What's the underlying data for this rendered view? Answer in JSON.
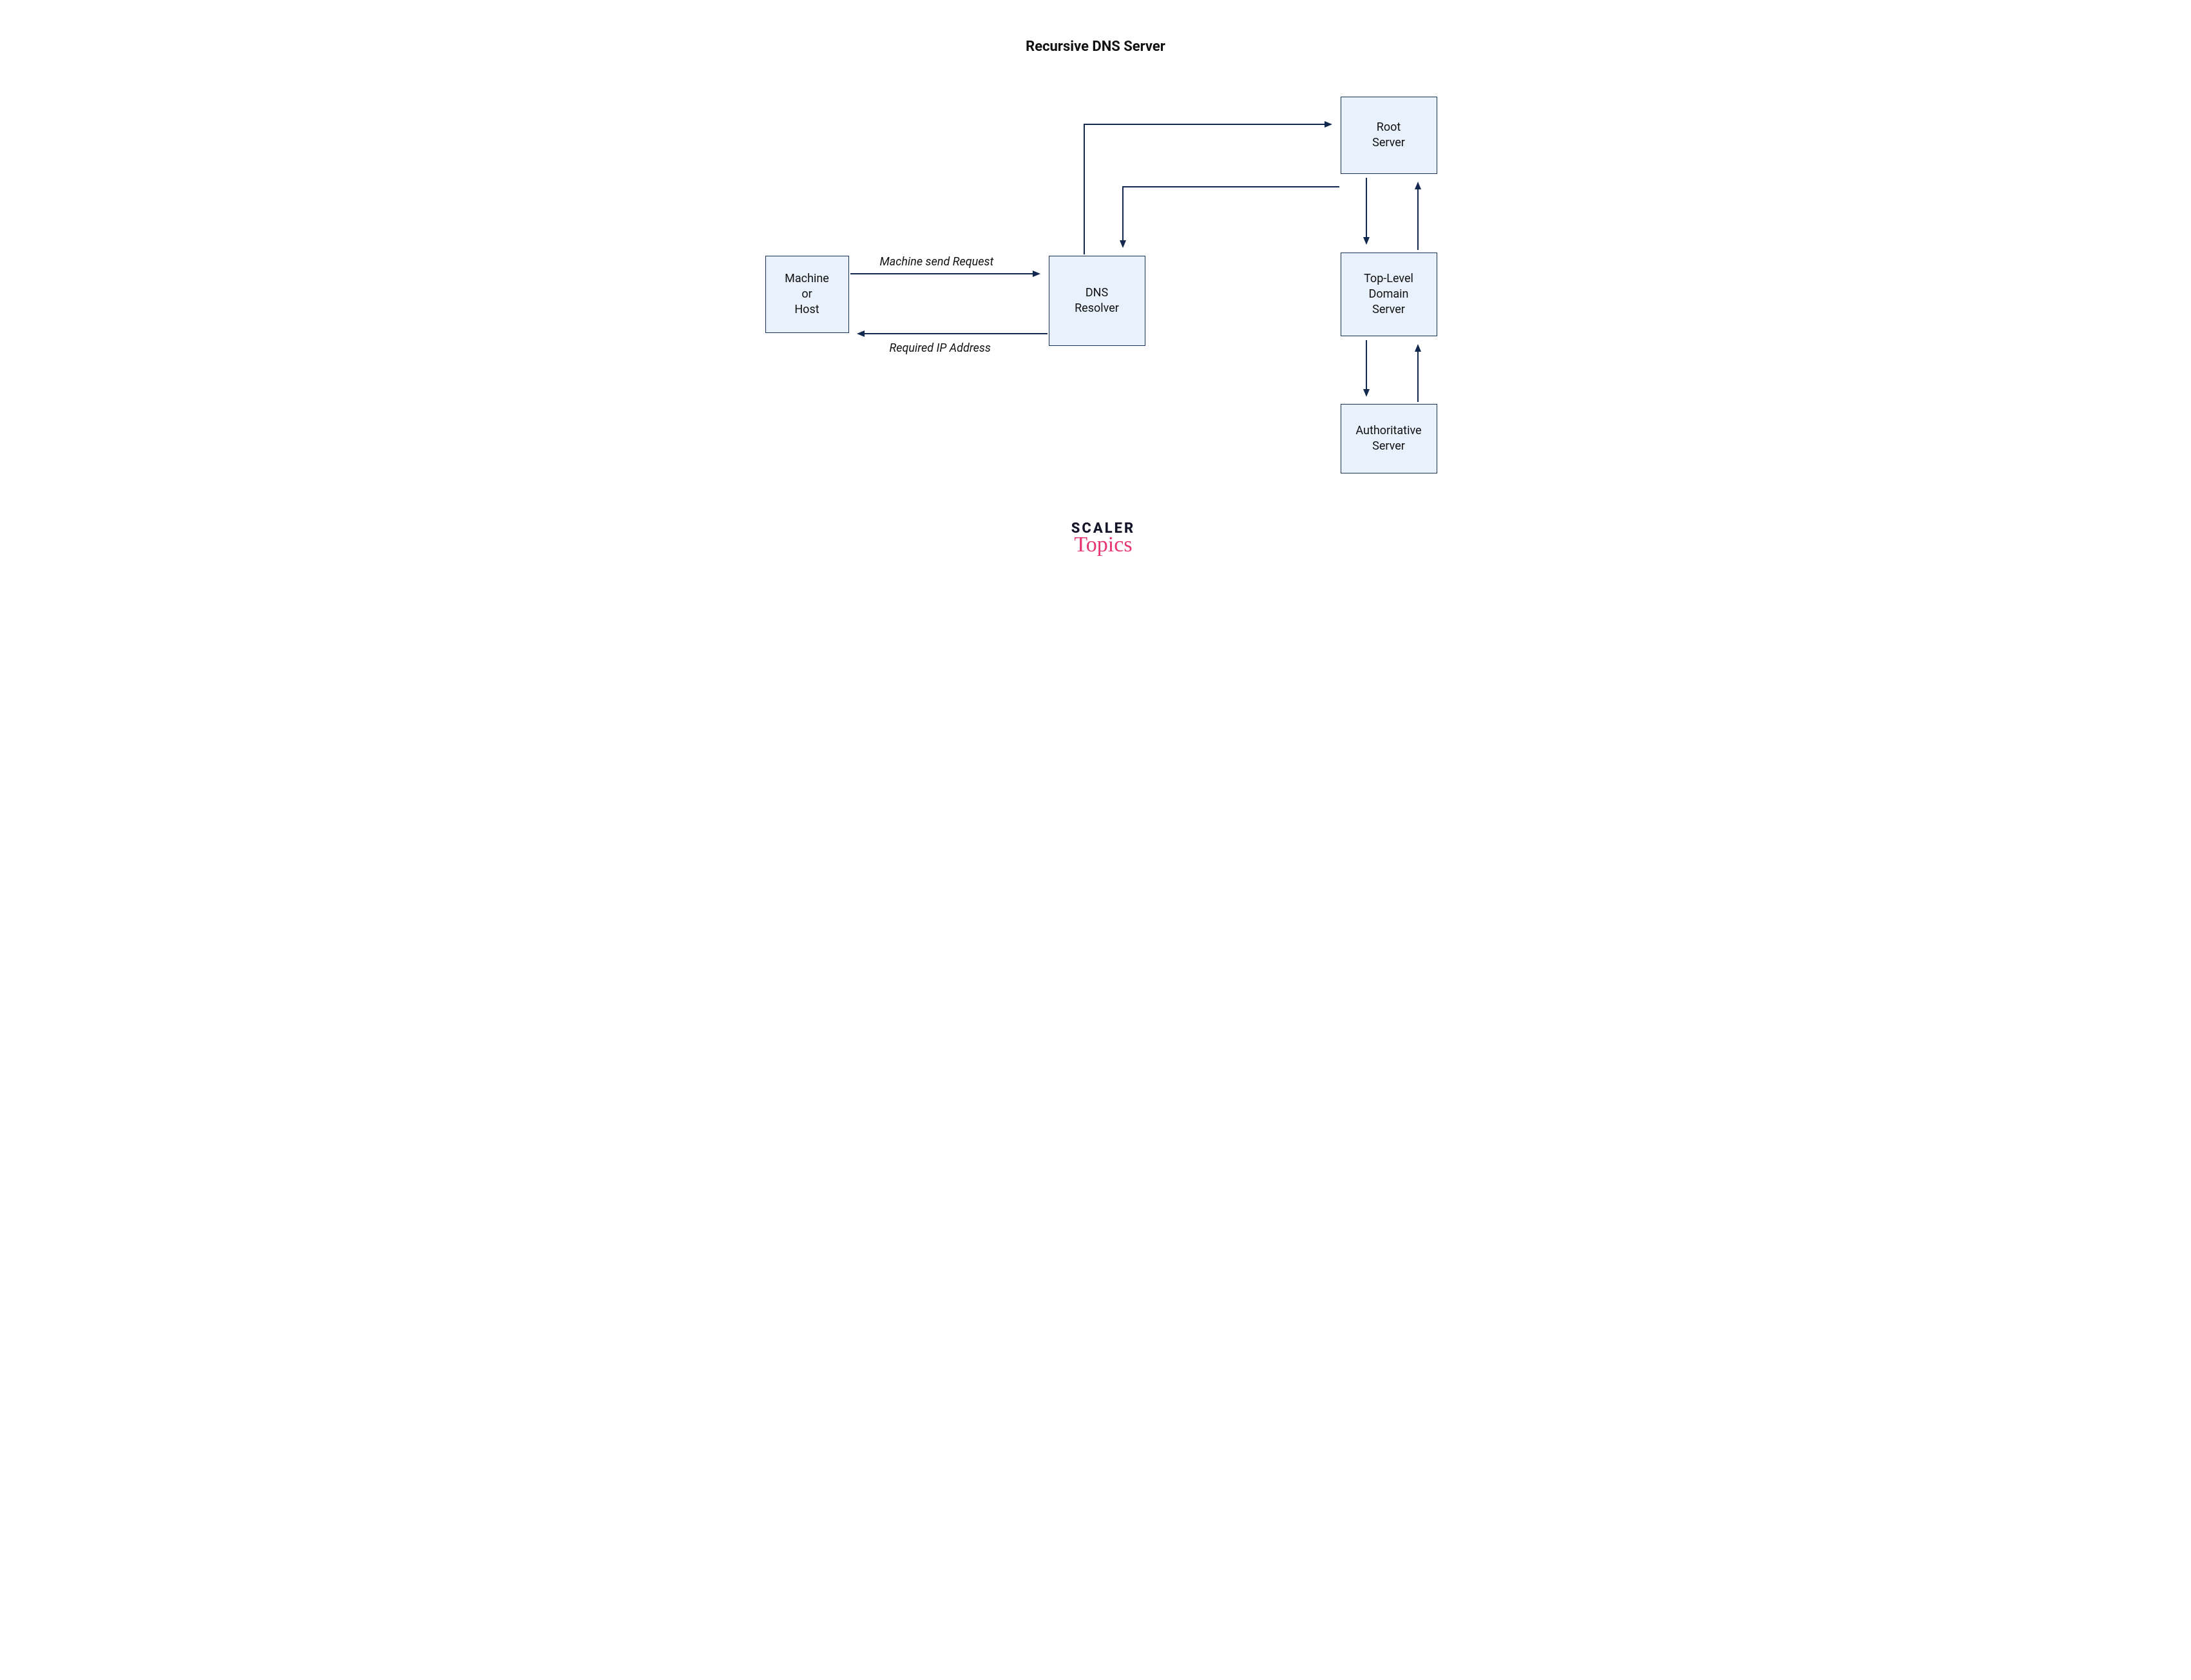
{
  "title": "Recursive DNS Server",
  "nodes": {
    "machine": "Machine\nor\nHost",
    "resolver": "DNS\nResolver",
    "root": "Root\nServer",
    "tld": "Top-Level\nDomain\nServer",
    "auth": "Authoritative\nServer"
  },
  "edge_labels": {
    "request": "Machine send Request",
    "response": "Required IP Address"
  },
  "brand": {
    "line1": "SCALER",
    "line2": "Topics"
  },
  "colors": {
    "node_fill": "#e8f1fc",
    "node_stroke": "#15315c",
    "arrow": "#13284e",
    "brand_dark": "#141428",
    "brand_pink": "#e6356f"
  }
}
